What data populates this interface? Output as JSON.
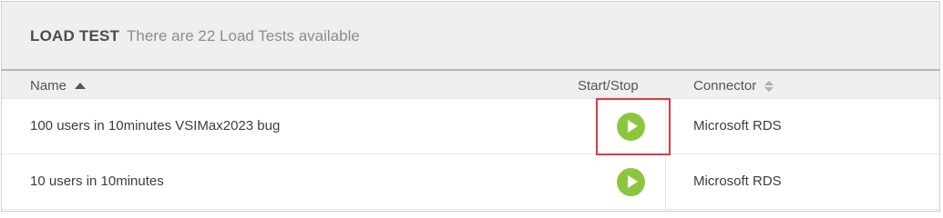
{
  "header": {
    "title": "LOAD TEST",
    "subtitle": "There are 22 Load Tests available"
  },
  "columns": {
    "name": "Name",
    "start_stop": "Start/Stop",
    "connector": "Connector"
  },
  "rows": [
    {
      "name": "100 users in 10minutes VSIMax2023 bug",
      "action": "play-icon",
      "connector": "Microsoft RDS"
    },
    {
      "name": "10 users in 10minutes",
      "action": "play-icon",
      "connector": "Microsoft RDS"
    }
  ],
  "colors": {
    "play_button": "#8cc63f",
    "highlight": "#e03a3e",
    "header_bg": "#efefef"
  }
}
